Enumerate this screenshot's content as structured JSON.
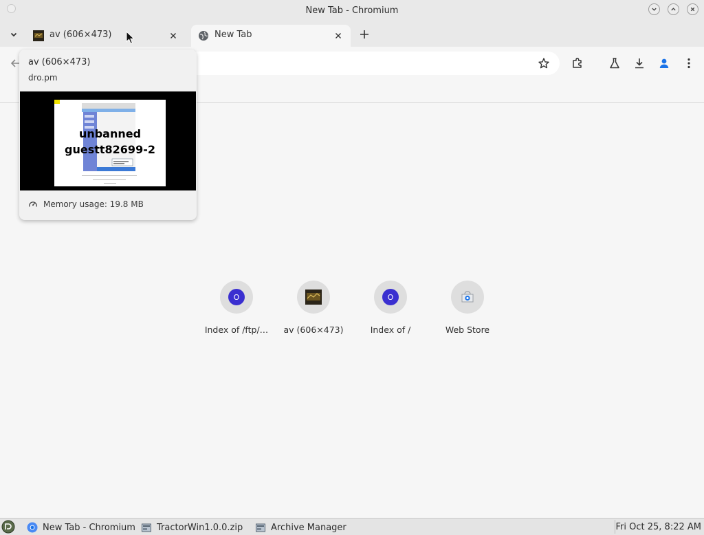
{
  "window": {
    "title": "New Tab - Chromium"
  },
  "tabs": [
    {
      "label": "av (606×473)",
      "favicon": "image-thumbnail-icon"
    },
    {
      "label": "New Tab",
      "favicon": "globe-icon"
    }
  ],
  "hover_card": {
    "title": "av (606×473)",
    "domain": "dro.pm",
    "preview_text_line1": "unbanned",
    "preview_text_line2": "guestt82699-2",
    "memory": "Memory usage: 19.8 MB"
  },
  "shortcuts": [
    {
      "label": "Index of /ftp/…",
      "icon": "opera-o-icon"
    },
    {
      "label": "av (606×473)",
      "icon": "image-thumbnail-icon"
    },
    {
      "label": "Index of /",
      "icon": "opera-o-icon"
    },
    {
      "label": "Web Store",
      "icon": "web-store-icon"
    }
  ],
  "taskbar": {
    "items": [
      {
        "label": "New Tab - Chromium"
      },
      {
        "label": "TractorWin1.0.0.zip"
      },
      {
        "label": "Archive Manager"
      }
    ],
    "clock": "Fri Oct 25,  8:22 AM"
  },
  "colors": {
    "opera_blue": "#3a2fd0",
    "profile_blue": "#1a73e8"
  }
}
